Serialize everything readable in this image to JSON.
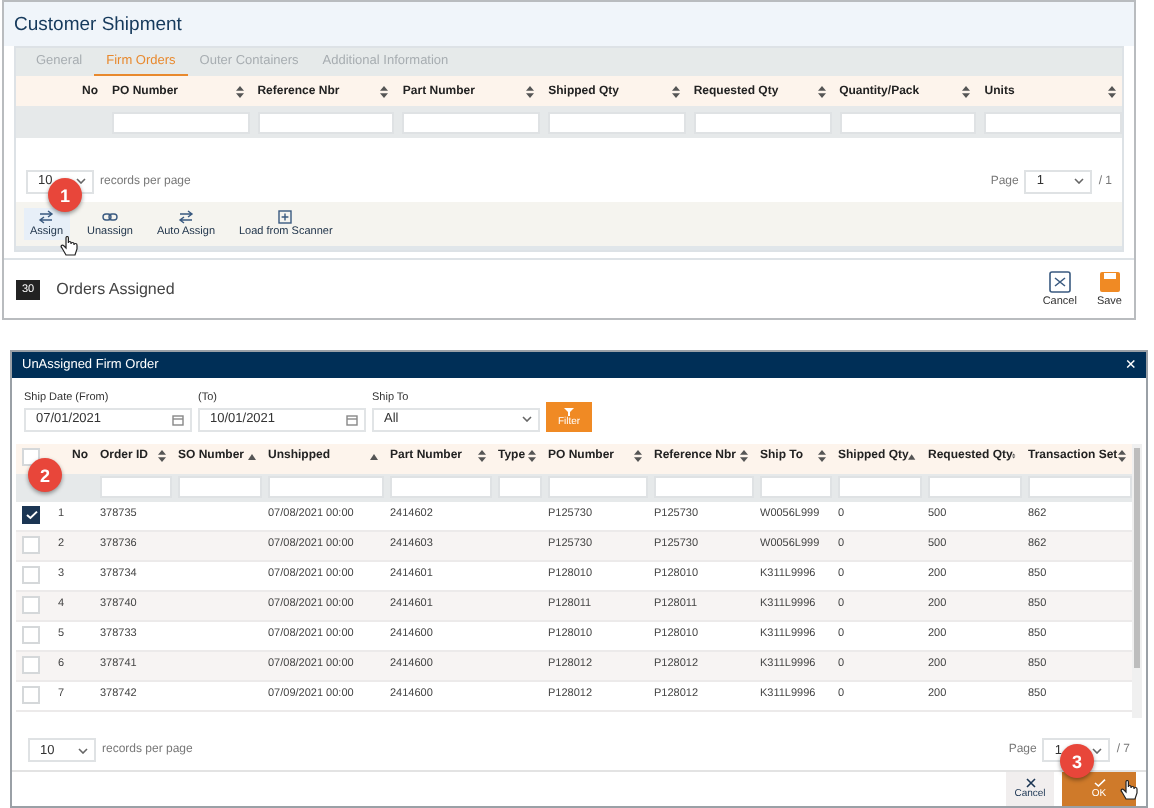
{
  "window": {
    "title": "Customer Shipment"
  },
  "tabs": [
    {
      "label": "General",
      "selected": false
    },
    {
      "label": "Firm Orders",
      "selected": true
    },
    {
      "label": "Outer Containers",
      "selected": false
    },
    {
      "label": "Additional Information",
      "selected": false
    }
  ],
  "grid": {
    "columns": [
      {
        "label": "No",
        "kind": "none"
      },
      {
        "label": "PO Number",
        "kind": "both"
      },
      {
        "label": "Reference Nbr",
        "kind": "both"
      },
      {
        "label": "Part Number",
        "kind": "both"
      },
      {
        "label": "Shipped Qty",
        "kind": "both"
      },
      {
        "label": "Requested Qty",
        "kind": "both"
      },
      {
        "label": "Quantity/Pack",
        "kind": "both"
      },
      {
        "label": "Units",
        "kind": "both"
      }
    ],
    "page_size": "10",
    "page_size_label": "records per page",
    "page_label": "Page",
    "page": "1",
    "page_total": "/ 1"
  },
  "toolbar": [
    {
      "label": "Assign",
      "kind": "arrows"
    },
    {
      "label": "Unassign",
      "kind": "link"
    },
    {
      "label": "Auto Assign",
      "kind": "arrows"
    },
    {
      "label": "Load from Scanner",
      "kind": "plus"
    }
  ],
  "footer": {
    "count": "30",
    "label": "Orders Assigned",
    "buttons": [
      {
        "label": "Cancel",
        "kind": "cancel"
      },
      {
        "label": "Save",
        "kind": "save"
      }
    ]
  },
  "dialog": {
    "title": "UnAssigned Firm Order",
    "close": "×",
    "filters": [
      {
        "label": "Ship Date (From)",
        "value": "07/01/2021",
        "kind": "date"
      },
      {
        "label": "(To)",
        "value": "10/01/2021",
        "kind": "date"
      },
      {
        "label": "Ship To",
        "value": "All",
        "kind": "select"
      }
    ],
    "filter_button": "Filter",
    "select_all_checked": false,
    "columns": [
      {
        "label": "No",
        "kind": "none"
      },
      {
        "label": "Order ID",
        "kind": "both"
      },
      {
        "label": "SO Number",
        "kind": "asc"
      },
      {
        "label": "Unshipped",
        "kind": "asc"
      },
      {
        "label": "Part Number",
        "kind": "both"
      },
      {
        "label": "Type",
        "kind": "both"
      },
      {
        "label": "PO Number",
        "kind": "both"
      },
      {
        "label": "Reference Nbr",
        "kind": "both"
      },
      {
        "label": "Ship To",
        "kind": "both"
      },
      {
        "label": "Shipped Qty",
        "kind": "asc"
      },
      {
        "label": "Requested Qty",
        "kind": "both"
      },
      {
        "label": "Transaction Set",
        "kind": "both"
      }
    ],
    "rows": [
      {
        "checked": true,
        "cells": [
          "1",
          "378735",
          "",
          "07/08/2021 00:00",
          "2414602",
          "",
          "P125730",
          "P125730",
          "W0056L999",
          "0",
          "500",
          "862"
        ]
      },
      {
        "checked": false,
        "cells": [
          "2",
          "378736",
          "",
          "07/08/2021 00:00",
          "2414603",
          "",
          "P125730",
          "P125730",
          "W0056L999",
          "0",
          "500",
          "862"
        ]
      },
      {
        "checked": false,
        "cells": [
          "3",
          "378734",
          "",
          "07/08/2021 00:00",
          "2414601",
          "",
          "P128010",
          "P128010",
          "K311L9996",
          "0",
          "200",
          "850"
        ]
      },
      {
        "checked": false,
        "cells": [
          "4",
          "378740",
          "",
          "07/08/2021 00:00",
          "2414601",
          "",
          "P128011",
          "P128011",
          "K311L9996",
          "0",
          "200",
          "850"
        ]
      },
      {
        "checked": false,
        "cells": [
          "5",
          "378733",
          "",
          "07/08/2021 00:00",
          "2414600",
          "",
          "P128010",
          "P128010",
          "K311L9996",
          "0",
          "200",
          "850"
        ]
      },
      {
        "checked": false,
        "cells": [
          "6",
          "378741",
          "",
          "07/08/2021 00:00",
          "2414600",
          "",
          "P128012",
          "P128012",
          "K311L9996",
          "0",
          "200",
          "850"
        ]
      },
      {
        "checked": false,
        "cells": [
          "7",
          "378742",
          "",
          "07/09/2021 00:00",
          "2414600",
          "",
          "P128012",
          "P128012",
          "K311L9996",
          "0",
          "200",
          "850"
        ]
      }
    ],
    "page_size": "10",
    "page_size_label": "records per page",
    "page_label": "Page",
    "page": "1",
    "page_total": "/ 7",
    "buttons": [
      {
        "label": "Cancel",
        "kind": "cancel"
      },
      {
        "label": "OK",
        "kind": "ok"
      }
    ]
  },
  "steps": [
    "1",
    "2",
    "3"
  ]
}
